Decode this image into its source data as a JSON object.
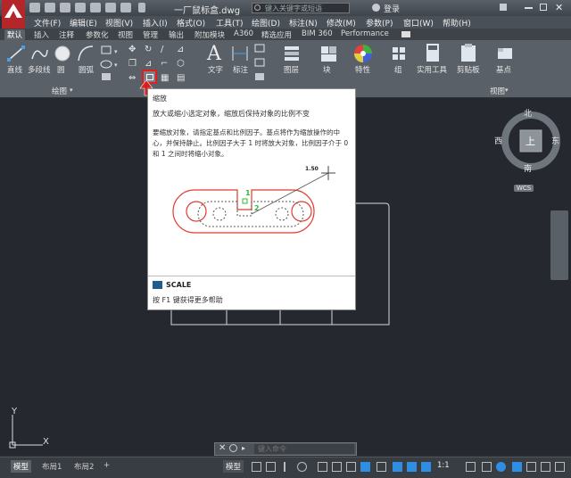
{
  "window": {
    "title": "一厂鼠标盒.dwg",
    "search_placeholder": "键入关键字或短语",
    "login_label": "登录"
  },
  "menubar": {
    "items": [
      "文件(F)",
      "编辑(E)",
      "视图(V)",
      "插入(I)",
      "格式(O)",
      "工具(T)",
      "绘图(D)",
      "标注(N)",
      "修改(M)",
      "参数(P)",
      "窗口(W)",
      "帮助(H)"
    ]
  },
  "ribbon": {
    "tabs": [
      "默认",
      "插入",
      "注释",
      "参数化",
      "视图",
      "管理",
      "输出",
      "附加模块",
      "A360",
      "精选应用",
      "BIM 360",
      "Performance"
    ],
    "active_tab": "默认",
    "tools": {
      "line": "直线",
      "polyline": "多段线",
      "circle": "圆",
      "arc": "圆弧",
      "text": "文字",
      "dimension": "标注",
      "layers": "图层",
      "block": "块",
      "properties": "特性",
      "group": "组",
      "utilities": "实用工具",
      "clipboard": "剪贴板",
      "base": "基点"
    },
    "panels": {
      "draw": "绘图",
      "view": "视图"
    }
  },
  "tooltip": {
    "title": "缩放",
    "description": "放大或缩小选定对象，缩放后保持对象的比例不变",
    "long_description": "要缩放对象，请指定基点和比例因子。基点将作为缩放操作的中心，并保持静止。比例因子大于 1 时将放大对象，比例因子介于 0 和 1 之间时将缩小对象。",
    "illustration": {
      "scale_value": "1.50",
      "step_1": "1",
      "step_2": "2"
    },
    "command": "SCALE",
    "help_hint": "按 F1 键获得更多帮助"
  },
  "viewcube": {
    "north": "北",
    "south": "南",
    "east": "东",
    "west": "西",
    "top_face": "上",
    "wcs": "WCS"
  },
  "ucs": {
    "x": "X",
    "y": "Y"
  },
  "command_line": {
    "placeholder": "键入命令"
  },
  "statusbar": {
    "layout_tabs": [
      "模型",
      "布局1",
      "布局2"
    ],
    "active_layout": "模型",
    "add_tab": "+",
    "model_button": "模型",
    "scale": "1:1"
  },
  "colors": {
    "app_red": "#b5262b",
    "ribbon_bg": "#5a6067",
    "canvas_bg": "#25282e",
    "tooltip_drawing_red": "#e23b2e",
    "tooltip_green": "#3bb33b",
    "status_blue": "#2f8de4"
  }
}
